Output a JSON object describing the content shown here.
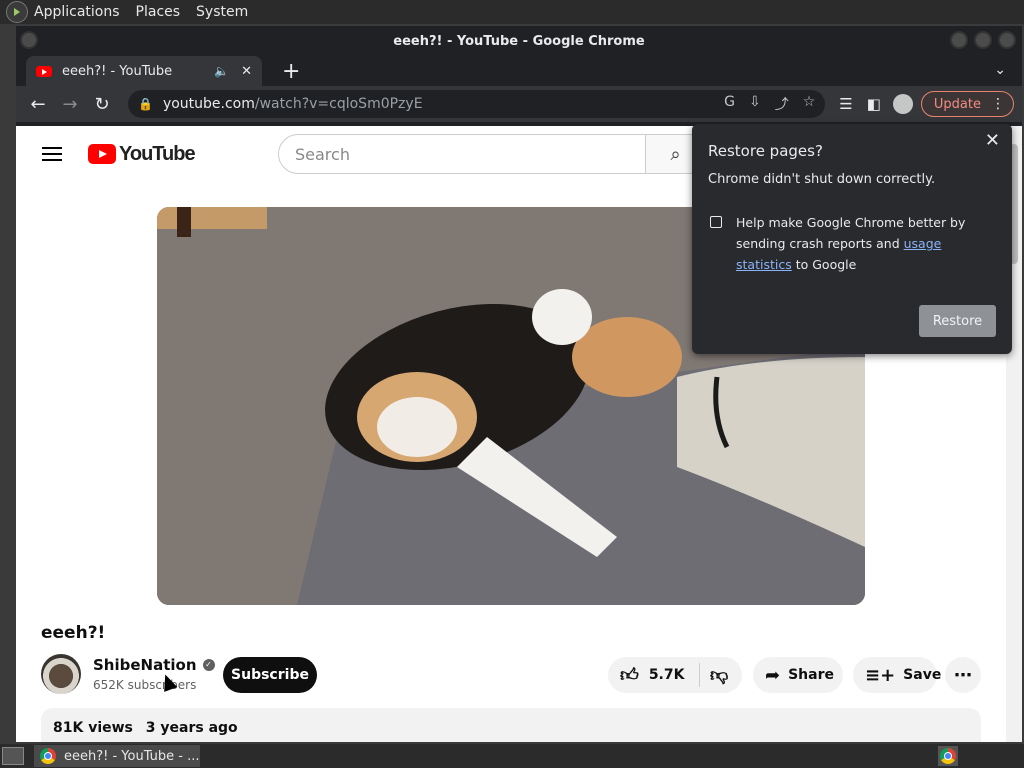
{
  "desktop": {
    "menus": [
      "Applications",
      "Places",
      "System"
    ]
  },
  "window": {
    "title": "eeeh?! - YouTube - Google Chrome"
  },
  "tab": {
    "title": "eeeh?! - YouTube",
    "close": "✕",
    "new_tab": "+"
  },
  "toolbar": {
    "url_host": "youtube.com",
    "url_path": "/watch?v=cqloSm0PzyE",
    "update_label": "Update"
  },
  "youtube": {
    "logo_text": "YouTube",
    "search_placeholder": "Search",
    "video_title": "eeeh?!",
    "channel_name": "ShibeNation",
    "subscribers": "652K subscribers",
    "subscribe_label": "Subscribe",
    "likes": "5.7K",
    "share_label": "Share",
    "save_label": "Save",
    "views": "81K views",
    "age": "3 years ago"
  },
  "popup": {
    "title": "Restore pages?",
    "message": "Chrome didn't shut down correctly.",
    "checkbox_text_1": "Help make Google Chrome better by sending crash reports and ",
    "checkbox_link": "usage statistics",
    "checkbox_text_2": " to Google",
    "restore_label": "Restore"
  },
  "taskbar": {
    "task_label": "eeeh?! - YouTube - ..."
  }
}
